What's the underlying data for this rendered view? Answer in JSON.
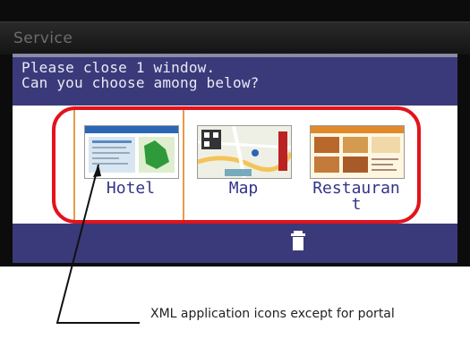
{
  "window": {
    "title": "Service"
  },
  "prompt": {
    "line1": "Please close 1 window.",
    "line2": "Can you choose among below?"
  },
  "apps": [
    {
      "label": "Hotel",
      "icon": "hotel-thumbnail-icon",
      "selected": true
    },
    {
      "label": "Map",
      "icon": "map-thumbnail-icon",
      "selected": false
    },
    {
      "label": "Restauran\nt",
      "icon": "restaurant-thumbnail-icon",
      "selected": false
    }
  ],
  "toolbar": {
    "delete_icon": "trash-icon"
  },
  "annotation": {
    "text": "XML application icons except for portal"
  },
  "colors": {
    "panel": "#3a3a7a",
    "highlight": "#e3131b",
    "selection": "#e89a4a",
    "label": "#34348a"
  }
}
